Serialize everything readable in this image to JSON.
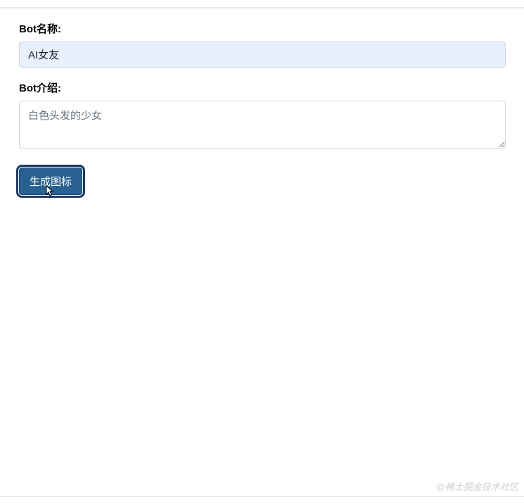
{
  "form": {
    "bot_name_label": "Bot名称:",
    "bot_name_value": "AI女友",
    "bot_intro_label": "Bot介绍:",
    "bot_intro_placeholder": "白色头发的少女",
    "generate_button_label": "生成图标"
  },
  "watermark_text": "@稀土掘金技术社区"
}
